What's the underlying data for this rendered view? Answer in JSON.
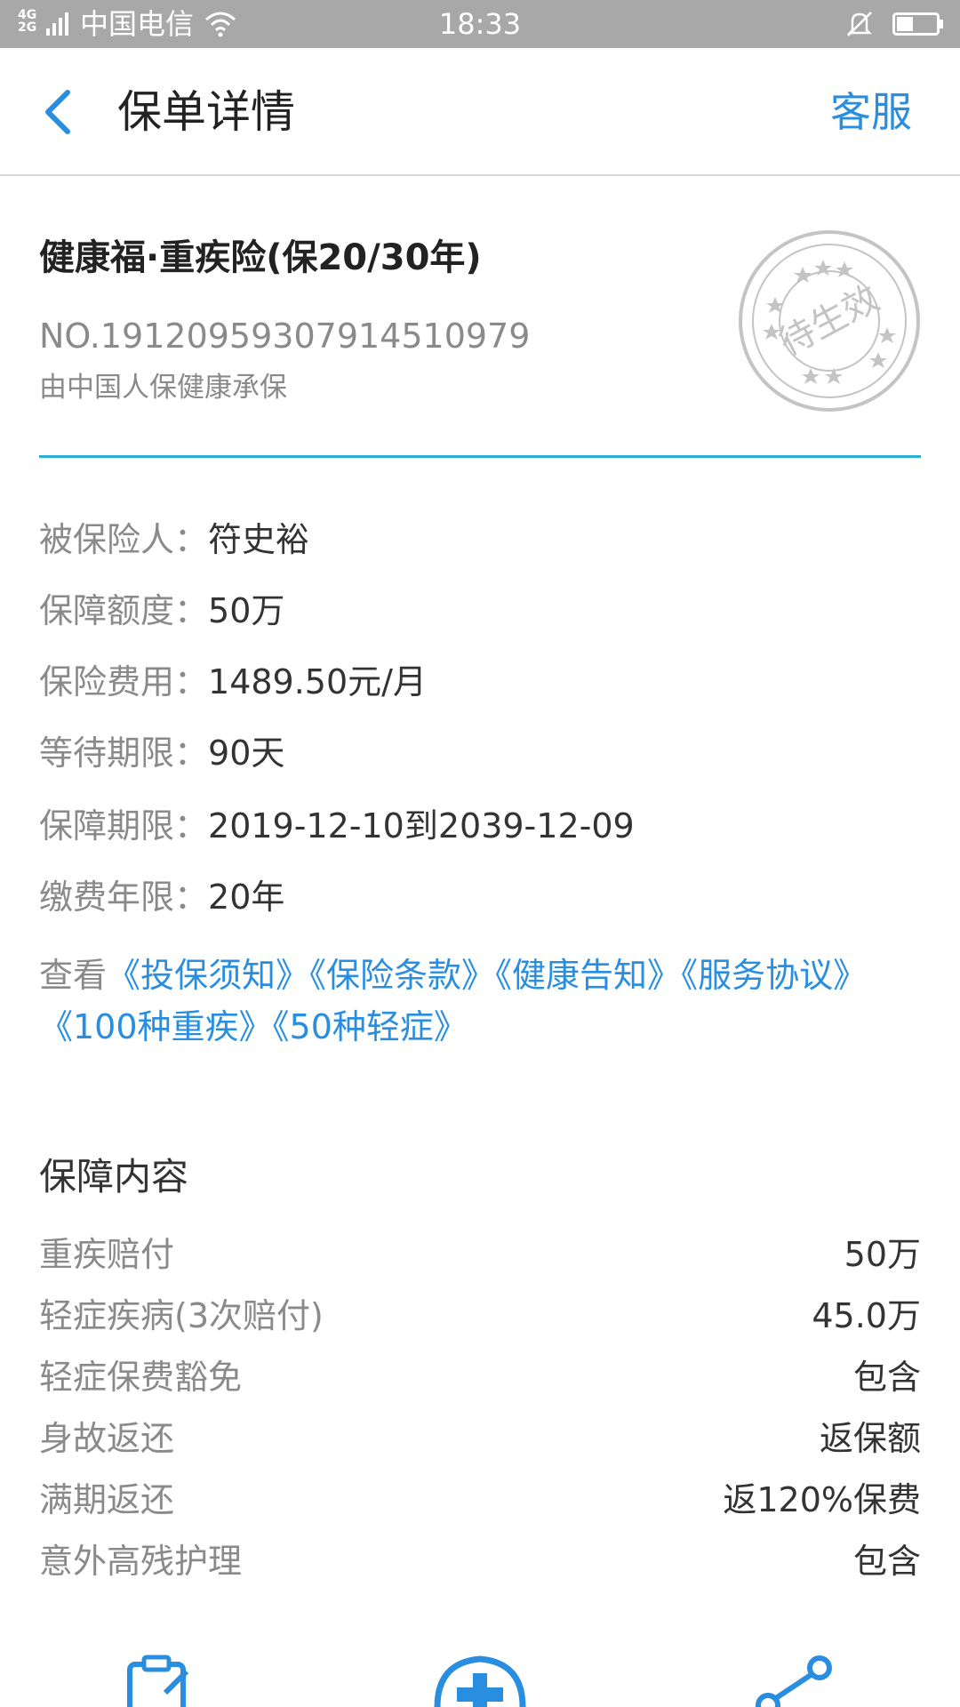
{
  "status_bar": {
    "network": "4G 2G",
    "carrier": "中国电信",
    "time": "18:33"
  },
  "navbar": {
    "title": "保单详情",
    "service_label": "客服"
  },
  "policy": {
    "product_name": "健康福·重疾险(保20/30年)",
    "policy_number": "NO.191209593079145109 79",
    "insurer": "由中国人保健康承保",
    "stamp_text": "待生效"
  },
  "info": [
    {
      "label": "被保险人：",
      "value": "符史裕"
    },
    {
      "label": "保障额度：",
      "value": "50万"
    },
    {
      "label": "保险费用：",
      "value": "1489.50元/月"
    },
    {
      "label": "等待期限：",
      "value": "90天"
    },
    {
      "label": "保障期限：",
      "value": "2019-12-10到2039-12-09"
    },
    {
      "label": "缴费年限：",
      "value": "20年"
    }
  ],
  "documents": {
    "prefix": "查看",
    "links": [
      "《投保须知》",
      "《保险条款》",
      "《健康告知》",
      "《服务协议》",
      "《100种重疾》",
      "《50种轻症》"
    ]
  },
  "coverage": {
    "title": "保障内容",
    "items": [
      {
        "label": "重疾赔付",
        "value": "50万"
      },
      {
        "label": "轻症疾病(3次赔付)",
        "value": "45.0万"
      },
      {
        "label": "轻症保费豁免",
        "value": "包含"
      },
      {
        "label": "身故返还",
        "value": "返保额"
      },
      {
        "label": "满期返还",
        "value": "返120%保费"
      },
      {
        "label": "意外高残护理",
        "value": "包含"
      }
    ]
  },
  "colors": {
    "accent": "#2a8ee0",
    "divider": "#2ab0d8",
    "status_bar": "#a8a8a8"
  }
}
